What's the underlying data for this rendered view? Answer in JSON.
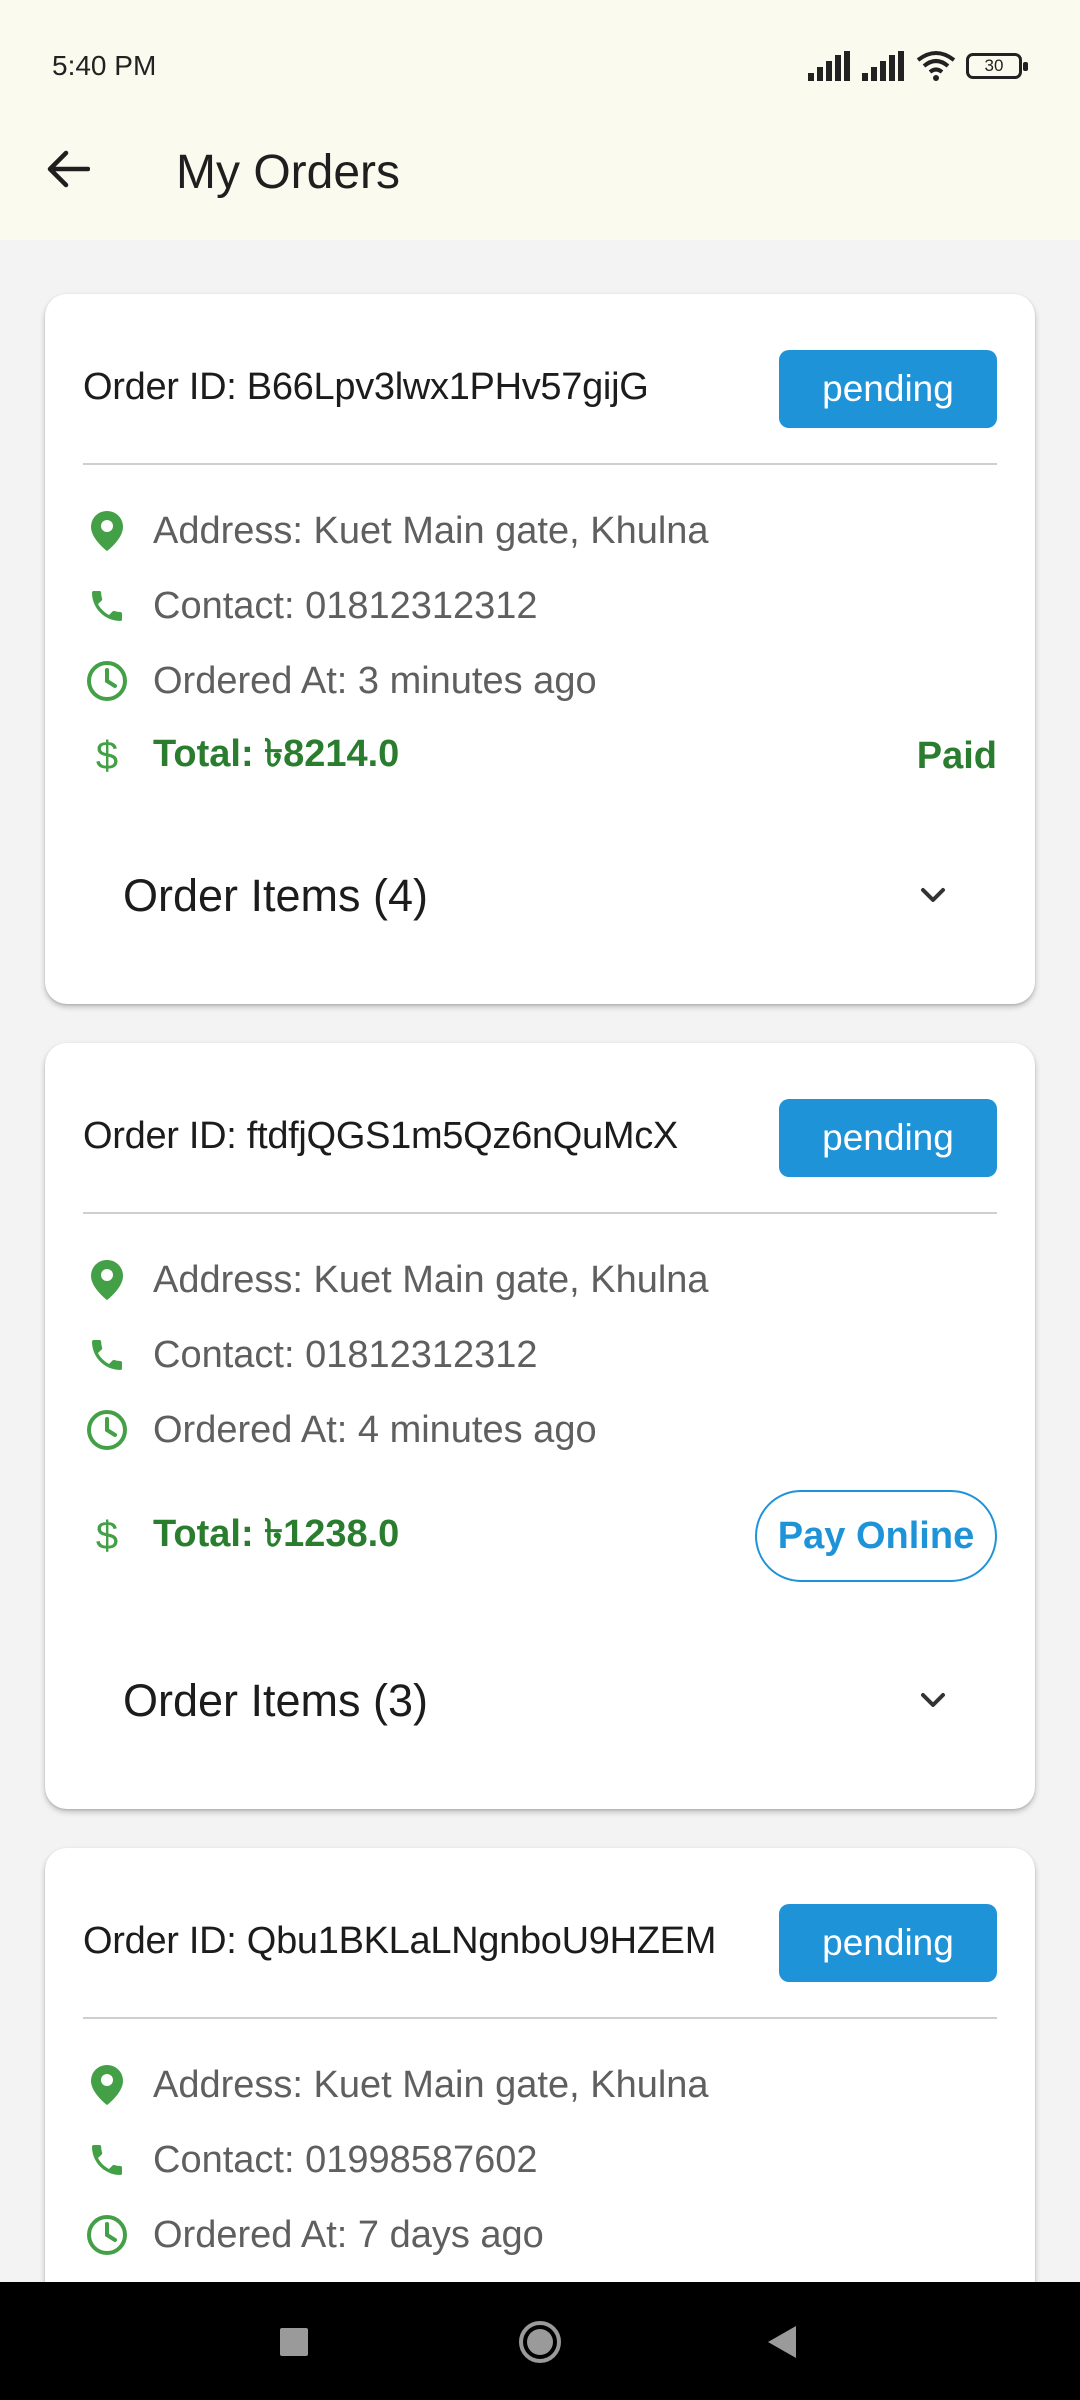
{
  "status_bar": {
    "time": "5:40 PM",
    "battery": "30"
  },
  "app_bar": {
    "title": "My Orders"
  },
  "orders": [
    {
      "id_text": "Order ID: B66Lpv3lwx1PHv57gijG",
      "status": "pending",
      "address": "Address: Kuet Main gate, Khulna",
      "contact": "Contact: 01812312312",
      "ordered_at": "Ordered At: 3 minutes ago",
      "total": "Total: ৳8214.0",
      "payment": "Paid",
      "items_label": "Order Items (4)"
    },
    {
      "id_text": "Order ID: ftdfjQGS1m5Qz6nQuMcX",
      "status": "pending",
      "address": "Address: Kuet Main gate, Khulna",
      "contact": "Contact: 01812312312",
      "ordered_at": "Ordered At: 4 minutes ago",
      "total": "Total: ৳1238.0",
      "pay_button": "Pay Online",
      "items_label": "Order Items (3)"
    },
    {
      "id_text": "Order ID: Qbu1BKLaLNgnboU9HZEM",
      "status": "pending",
      "address": "Address: Kuet Main gate, Khulna",
      "contact": "Contact: 01998587602",
      "ordered_at": "Ordered At: 7 days ago"
    }
  ],
  "colors": {
    "accent_blue": "#1f93d8",
    "green": "#2a7d2e",
    "icon_green": "#43a047",
    "app_bar_bg": "#fbfaee"
  },
  "icons": {
    "back": "arrow-left-icon",
    "address": "location-pin-icon",
    "contact": "phone-icon",
    "time": "clock-icon",
    "total": "dollar-icon",
    "expand": "chevron-down-icon"
  }
}
